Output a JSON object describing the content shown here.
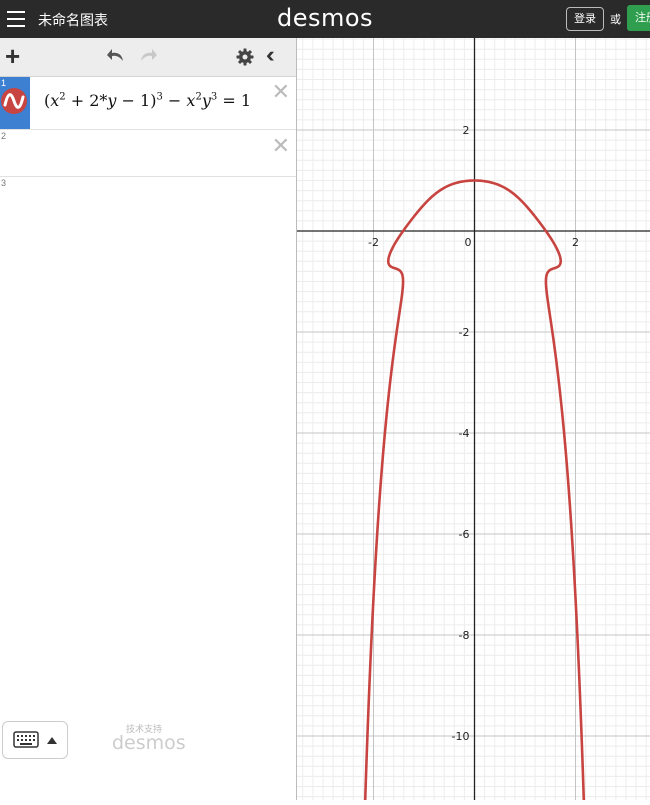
{
  "header": {
    "title": "未命名图表",
    "logo": "desmos",
    "login_label": "登录",
    "or_label": "或",
    "signup_label": "注册"
  },
  "toolbar": {
    "add_icon": "plus-icon",
    "undo_icon": "undo-icon",
    "redo_icon": "redo-icon",
    "settings_icon": "gear-icon",
    "collapse_icon": "double-chevron-left-icon"
  },
  "expressions": [
    {
      "number": "1",
      "color": "#c74440",
      "latex": "(x^2+2*y-1)^3-x^2y^3=1",
      "parts": {
        "open": "(",
        "x1": "x",
        "e1": "2",
        "mid1": " + 2*",
        "y1": "y",
        "mid2": " − 1)",
        "e2": "3",
        "mid3": " − ",
        "x2": "x",
        "e3": "2",
        "y2": "y",
        "e4": "3",
        "end": " = 1"
      }
    },
    {
      "number": "2",
      "latex": ""
    },
    {
      "number": "3",
      "latex": ""
    }
  ],
  "footer": {
    "powered_by": "技术支持",
    "logo": "desmos",
    "keyboard_icon": "keyboard-icon"
  },
  "graph": {
    "x_ticks": [
      "-2",
      "0",
      "2"
    ],
    "y_ticks": [
      "2",
      "-2",
      "-4",
      "-6",
      "-8",
      "-10"
    ],
    "curve_color": "#c74440",
    "x_range": [
      -3.5,
      3.5
    ],
    "y_range": [
      -11.4,
      3.8
    ]
  }
}
